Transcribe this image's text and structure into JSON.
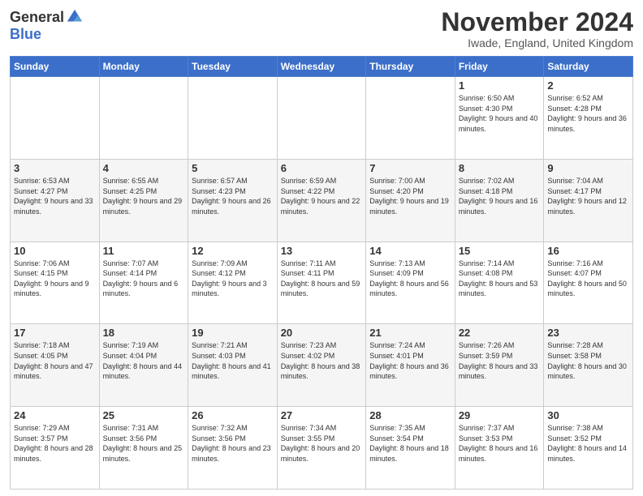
{
  "header": {
    "logo_general": "General",
    "logo_blue": "Blue",
    "month_title": "November 2024",
    "location": "Iwade, England, United Kingdom"
  },
  "weekdays": [
    "Sunday",
    "Monday",
    "Tuesday",
    "Wednesday",
    "Thursday",
    "Friday",
    "Saturday"
  ],
  "weeks": [
    [
      {
        "day": "",
        "info": ""
      },
      {
        "day": "",
        "info": ""
      },
      {
        "day": "",
        "info": ""
      },
      {
        "day": "",
        "info": ""
      },
      {
        "day": "",
        "info": ""
      },
      {
        "day": "1",
        "info": "Sunrise: 6:50 AM\nSunset: 4:30 PM\nDaylight: 9 hours\nand 40 minutes."
      },
      {
        "day": "2",
        "info": "Sunrise: 6:52 AM\nSunset: 4:28 PM\nDaylight: 9 hours\nand 36 minutes."
      }
    ],
    [
      {
        "day": "3",
        "info": "Sunrise: 6:53 AM\nSunset: 4:27 PM\nDaylight: 9 hours\nand 33 minutes."
      },
      {
        "day": "4",
        "info": "Sunrise: 6:55 AM\nSunset: 4:25 PM\nDaylight: 9 hours\nand 29 minutes."
      },
      {
        "day": "5",
        "info": "Sunrise: 6:57 AM\nSunset: 4:23 PM\nDaylight: 9 hours\nand 26 minutes."
      },
      {
        "day": "6",
        "info": "Sunrise: 6:59 AM\nSunset: 4:22 PM\nDaylight: 9 hours\nand 22 minutes."
      },
      {
        "day": "7",
        "info": "Sunrise: 7:00 AM\nSunset: 4:20 PM\nDaylight: 9 hours\nand 19 minutes."
      },
      {
        "day": "8",
        "info": "Sunrise: 7:02 AM\nSunset: 4:18 PM\nDaylight: 9 hours\nand 16 minutes."
      },
      {
        "day": "9",
        "info": "Sunrise: 7:04 AM\nSunset: 4:17 PM\nDaylight: 9 hours\nand 12 minutes."
      }
    ],
    [
      {
        "day": "10",
        "info": "Sunrise: 7:06 AM\nSunset: 4:15 PM\nDaylight: 9 hours\nand 9 minutes."
      },
      {
        "day": "11",
        "info": "Sunrise: 7:07 AM\nSunset: 4:14 PM\nDaylight: 9 hours\nand 6 minutes."
      },
      {
        "day": "12",
        "info": "Sunrise: 7:09 AM\nSunset: 4:12 PM\nDaylight: 9 hours\nand 3 minutes."
      },
      {
        "day": "13",
        "info": "Sunrise: 7:11 AM\nSunset: 4:11 PM\nDaylight: 8 hours\nand 59 minutes."
      },
      {
        "day": "14",
        "info": "Sunrise: 7:13 AM\nSunset: 4:09 PM\nDaylight: 8 hours\nand 56 minutes."
      },
      {
        "day": "15",
        "info": "Sunrise: 7:14 AM\nSunset: 4:08 PM\nDaylight: 8 hours\nand 53 minutes."
      },
      {
        "day": "16",
        "info": "Sunrise: 7:16 AM\nSunset: 4:07 PM\nDaylight: 8 hours\nand 50 minutes."
      }
    ],
    [
      {
        "day": "17",
        "info": "Sunrise: 7:18 AM\nSunset: 4:05 PM\nDaylight: 8 hours\nand 47 minutes."
      },
      {
        "day": "18",
        "info": "Sunrise: 7:19 AM\nSunset: 4:04 PM\nDaylight: 8 hours\nand 44 minutes."
      },
      {
        "day": "19",
        "info": "Sunrise: 7:21 AM\nSunset: 4:03 PM\nDaylight: 8 hours\nand 41 minutes."
      },
      {
        "day": "20",
        "info": "Sunrise: 7:23 AM\nSunset: 4:02 PM\nDaylight: 8 hours\nand 38 minutes."
      },
      {
        "day": "21",
        "info": "Sunrise: 7:24 AM\nSunset: 4:01 PM\nDaylight: 8 hours\nand 36 minutes."
      },
      {
        "day": "22",
        "info": "Sunrise: 7:26 AM\nSunset: 3:59 PM\nDaylight: 8 hours\nand 33 minutes."
      },
      {
        "day": "23",
        "info": "Sunrise: 7:28 AM\nSunset: 3:58 PM\nDaylight: 8 hours\nand 30 minutes."
      }
    ],
    [
      {
        "day": "24",
        "info": "Sunrise: 7:29 AM\nSunset: 3:57 PM\nDaylight: 8 hours\nand 28 minutes."
      },
      {
        "day": "25",
        "info": "Sunrise: 7:31 AM\nSunset: 3:56 PM\nDaylight: 8 hours\nand 25 minutes."
      },
      {
        "day": "26",
        "info": "Sunrise: 7:32 AM\nSunset: 3:56 PM\nDaylight: 8 hours\nand 23 minutes."
      },
      {
        "day": "27",
        "info": "Sunrise: 7:34 AM\nSunset: 3:55 PM\nDaylight: 8 hours\nand 20 minutes."
      },
      {
        "day": "28",
        "info": "Sunrise: 7:35 AM\nSunset: 3:54 PM\nDaylight: 8 hours\nand 18 minutes."
      },
      {
        "day": "29",
        "info": "Sunrise: 7:37 AM\nSunset: 3:53 PM\nDaylight: 8 hours\nand 16 minutes."
      },
      {
        "day": "30",
        "info": "Sunrise: 7:38 AM\nSunset: 3:52 PM\nDaylight: 8 hours\nand 14 minutes."
      }
    ]
  ]
}
